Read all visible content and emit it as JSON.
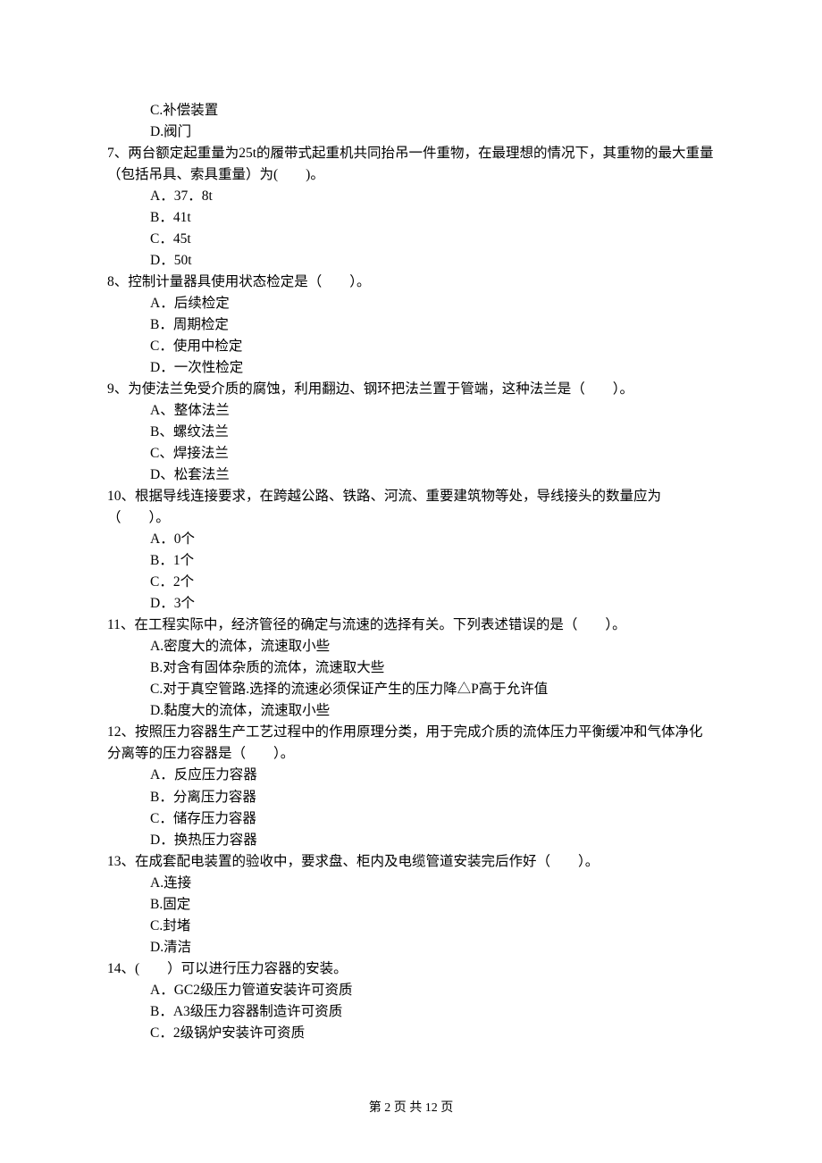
{
  "leading_options": [
    "C.补偿装置",
    "D.阀门"
  ],
  "questions": [
    {
      "num": "7",
      "stem": "两台额定起重量为25t的履带式起重机共同抬吊一件重物，在最理想的情况下，其重物的最大重量（包括吊具、索具重量）为(　　)。",
      "stem_wrap": true,
      "options": [
        "A．37．8t",
        "B．41t",
        "C．45t",
        "D．50t"
      ]
    },
    {
      "num": "8",
      "stem": "控制计量器具使用状态检定是（　　）。",
      "options": [
        "A．后续检定",
        "B．周期检定",
        "C．使用中检定",
        "D．一次性检定"
      ]
    },
    {
      "num": "9",
      "stem": "为使法兰免受介质的腐蚀，利用翻边、钢环把法兰置于管端，这种法兰是（　　）。",
      "options": [
        "A、整体法兰",
        "B、螺纹法兰",
        "C、焊接法兰",
        "D、松套法兰"
      ]
    },
    {
      "num": "10",
      "stem": "根据导线连接要求，在跨越公路、铁路、河流、重要建筑物等处，导线接头的数量应为（　　）。",
      "stem_wrap": true,
      "options": [
        "A．0个",
        "B．1个",
        "C．2个",
        "D．3个"
      ]
    },
    {
      "num": "11",
      "stem": "在工程实际中，经济管径的确定与流速的选择有关。下列表述错误的是（　　）。",
      "options": [
        "A.密度大的流体，流速取小些",
        "B.对含有固体杂质的流体，流速取大些",
        "C.对于真空管路.选择的流速必须保证产生的压力降△P高于允许值",
        "D.黏度大的流体，流速取小些"
      ]
    },
    {
      "num": "12",
      "stem": "按照压力容器生产工艺过程中的作用原理分类，用于完成介质的流体压力平衡缓冲和气体净化分离等的压力容器是（　　）。",
      "stem_wrap": true,
      "options": [
        "A．反应压力容器",
        "B．分离压力容器",
        "C．储存压力容器",
        "D．换热压力容器"
      ]
    },
    {
      "num": "13",
      "stem": "在成套配电装置的验收中，要求盘、柜内及电缆管道安装完后作好（　　）。",
      "options": [
        "A.连接",
        "B.固定",
        "C.封堵",
        "D.清洁"
      ]
    },
    {
      "num": "14",
      "stem": "(　　）可以进行压力容器的安装。",
      "options": [
        "A．GC2级压力管道安装许可资质",
        "B．A3级压力容器制造许可资质",
        "C．2级锅炉安装许可资质"
      ]
    }
  ],
  "footer": "第 2 页 共 12 页"
}
